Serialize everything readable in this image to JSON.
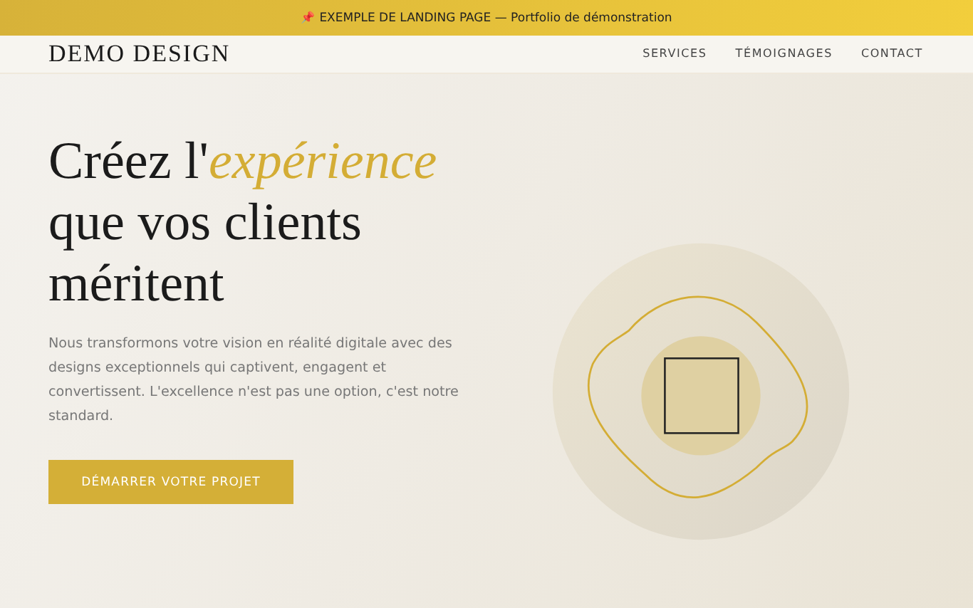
{
  "banner": {
    "pin": "📌",
    "text": "EXEMPLE DE LANDING PAGE — Portfolio de démonstration"
  },
  "header": {
    "logo": "DEMO DESIGN",
    "nav": [
      "SERVICES",
      "TÉMOIGNAGES",
      "CONTACT"
    ]
  },
  "hero": {
    "title": "Créez l'*expérience* que vos clients méritent",
    "text": "Nous transformons votre vision en réalité digitale avec des designs exceptionnels qui captivent, engagent et convertissent. L'excellence n'est pas une option, c'est notre standard.",
    "button": "DÉMARRER VOTRE PROJET"
  }
}
